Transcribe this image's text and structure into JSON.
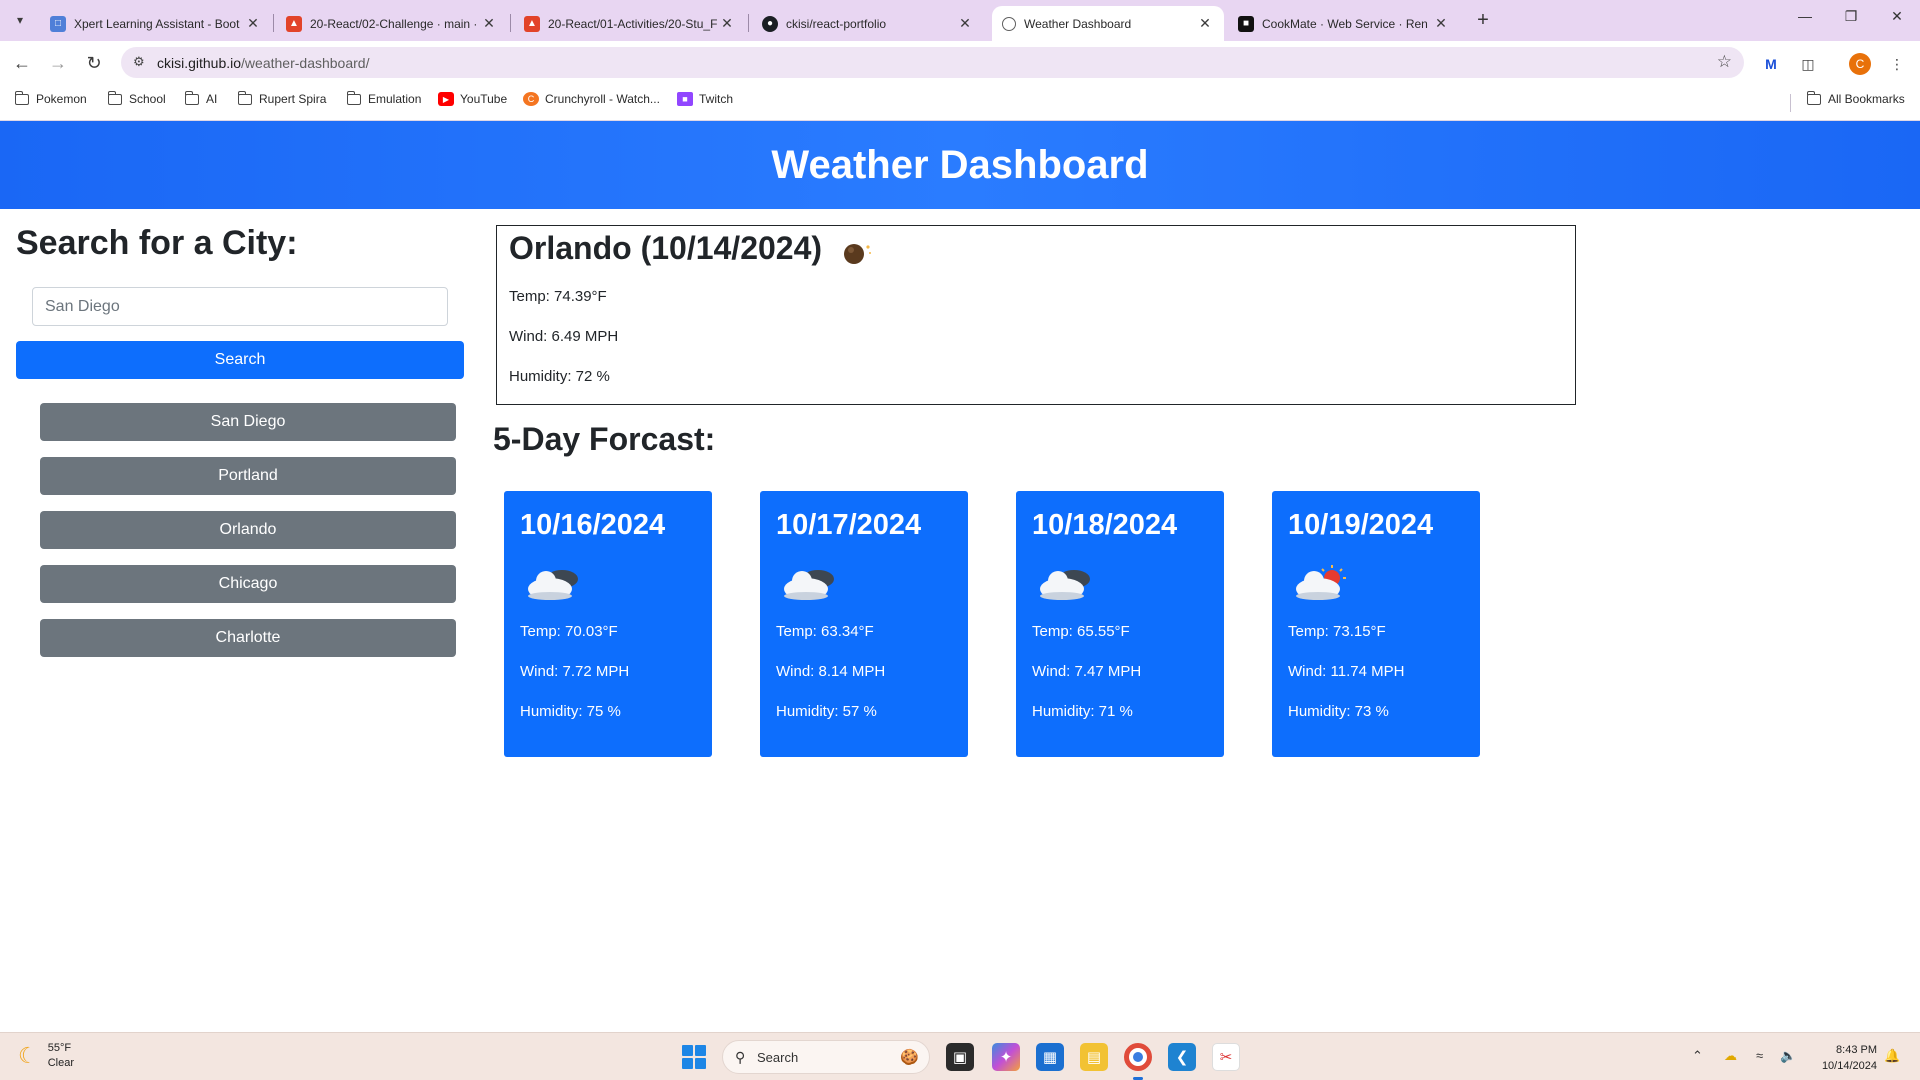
{
  "browser": {
    "tabs": [
      {
        "title": "Xpert Learning Assistant - Boot",
        "icon": "document-icon",
        "color": "#4f7fd8"
      },
      {
        "title": "20-React/02-Challenge · main ·",
        "icon": "gitlab-icon",
        "color": "#e24329"
      },
      {
        "title": "20-React/01-Activities/20-Stu_F",
        "icon": "gitlab-icon",
        "color": "#e24329"
      },
      {
        "title": "ckisi/react-portfolio",
        "icon": "github-icon",
        "color": "#1b1f24"
      },
      {
        "title": "Weather Dashboard",
        "icon": "globe-icon",
        "color": "#5f5f5f"
      },
      {
        "title": "CookMate · Web Service · Ren",
        "icon": "render-icon",
        "color": "#111111"
      }
    ],
    "url_host": "ckisi.github.io",
    "url_path": "/weather-dashboard/",
    "bookmarks": [
      {
        "label": "Pokemon",
        "icon": "folder-icon"
      },
      {
        "label": "School",
        "icon": "folder-icon"
      },
      {
        "label": "AI",
        "icon": "folder-icon"
      },
      {
        "label": "Rupert Spira",
        "icon": "folder-icon"
      },
      {
        "label": "Emulation",
        "icon": "folder-icon"
      },
      {
        "label": "YouTube",
        "icon": "youtube-icon"
      },
      {
        "label": "Crunchyroll - Watch...",
        "icon": "crunchyroll-icon"
      },
      {
        "label": "Twitch",
        "icon": "twitch-icon"
      }
    ],
    "all_bookmarks": "All Bookmarks",
    "profile_initial": "C"
  },
  "header": {
    "title": "Weather Dashboard"
  },
  "search": {
    "heading": "Search for a City:",
    "placeholder": "San Diego",
    "button_label": "Search",
    "history": [
      "San Diego",
      "Portland",
      "Orlando",
      "Chicago",
      "Charlotte"
    ]
  },
  "current": {
    "city_date": "Orlando (10/14/2024)",
    "icon": "night-clear-icon",
    "temp": "Temp: 74.39°F",
    "wind": "Wind: 6.49 MPH",
    "humidity": "Humidity: 72 %"
  },
  "forecast": {
    "heading": "5-Day Forcast:",
    "days": [
      {
        "date": "10/16/2024",
        "icon": "cloudy-night-icon",
        "temp": "Temp: 70.03°F",
        "wind": "Wind: 7.72 MPH",
        "humidity": "Humidity: 75 %"
      },
      {
        "date": "10/17/2024",
        "icon": "cloudy-night-icon",
        "temp": "Temp: 63.34°F",
        "wind": "Wind: 8.14 MPH",
        "humidity": "Humidity: 57 %"
      },
      {
        "date": "10/18/2024",
        "icon": "cloudy-night-icon",
        "temp": "Temp: 65.55°F",
        "wind": "Wind: 7.47 MPH",
        "humidity": "Humidity: 71 %"
      },
      {
        "date": "10/19/2024",
        "icon": "partly-sunny-icon",
        "temp": "Temp: 73.15°F",
        "wind": "Wind: 11.74 MPH",
        "humidity": "Humidity: 73 %"
      }
    ]
  },
  "taskbar": {
    "weather_temp": "55°F",
    "weather_desc": "Clear",
    "search_label": "Search",
    "time": "8:43 PM",
    "date": "10/14/2024"
  },
  "colors": {
    "header_blue": "#1a67f5",
    "card_blue": "#0d6efd",
    "history_gray": "#6c757d"
  }
}
